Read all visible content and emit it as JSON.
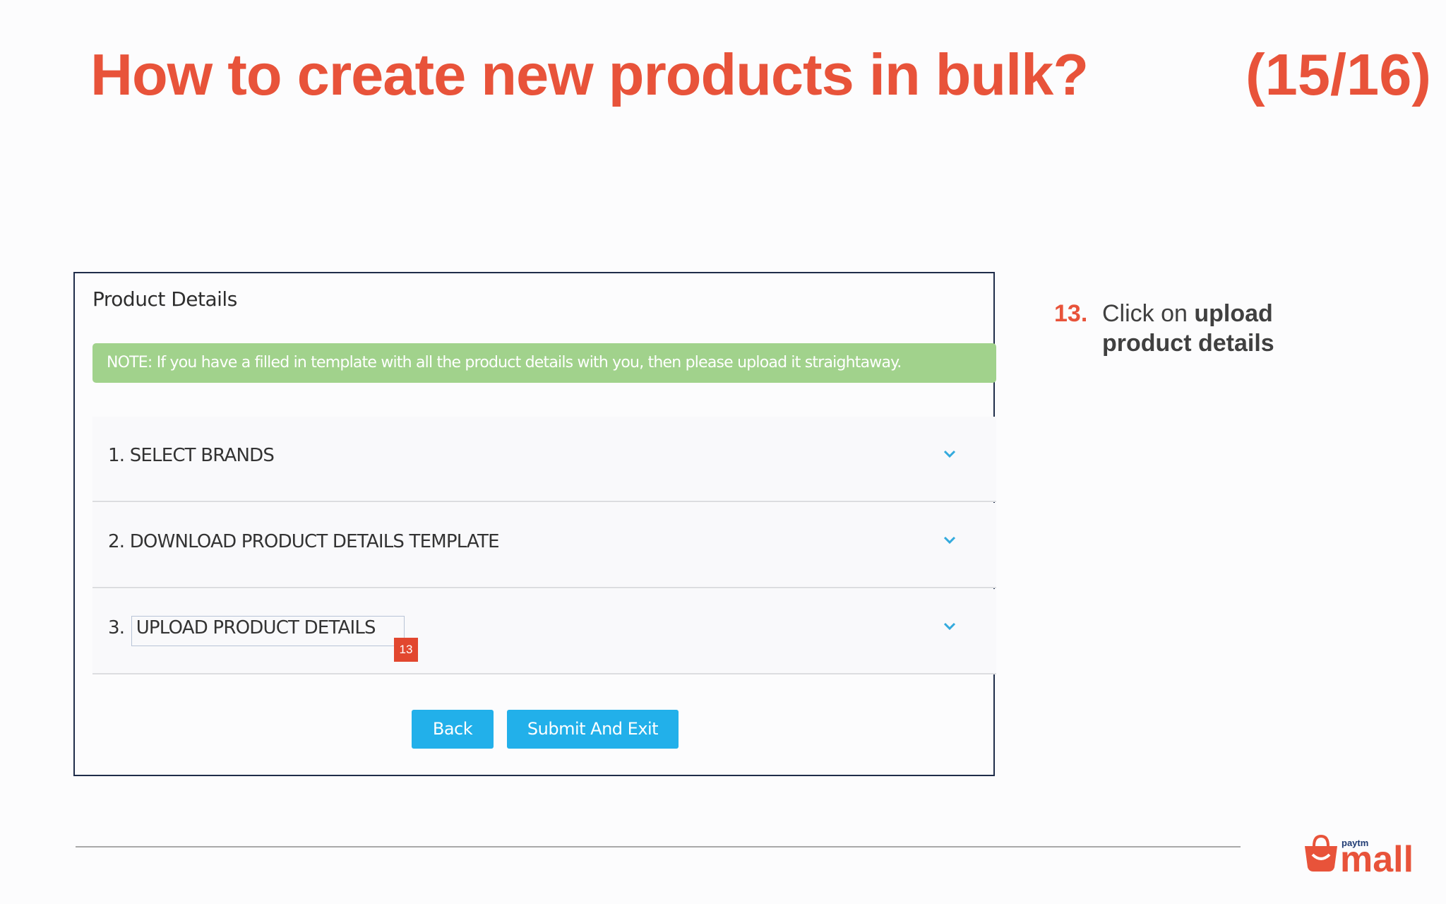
{
  "slide": {
    "title": "How to create new products in bulk?",
    "counter": "(15/16)"
  },
  "screenshot": {
    "title": "Product Details",
    "note": "NOTE: If you have a filled in template with all the product details with you, then please upload it straightaway.",
    "sections": [
      {
        "number": "1.",
        "label": "SELECT BRANDS"
      },
      {
        "number": "2.",
        "label": "DOWNLOAD PRODUCT DETAILS TEMPLATE"
      },
      {
        "number": "3.",
        "label": "UPLOAD PRODUCT DETAILS"
      }
    ],
    "callout_badge": "13",
    "buttons": {
      "back": "Back",
      "submit": "Submit And Exit"
    },
    "colors": {
      "note_bg": "#a1d28c",
      "button": "#22b0ea",
      "badge": "#e2472f"
    }
  },
  "instruction": {
    "number": "13.",
    "text_plain": "Click on ",
    "text_bold_1": "upload",
    "text_bold_2": "product details"
  },
  "logo": {
    "small_text": "paytm",
    "large_text": "mall"
  },
  "colors": {
    "accent": "#e8533a"
  }
}
